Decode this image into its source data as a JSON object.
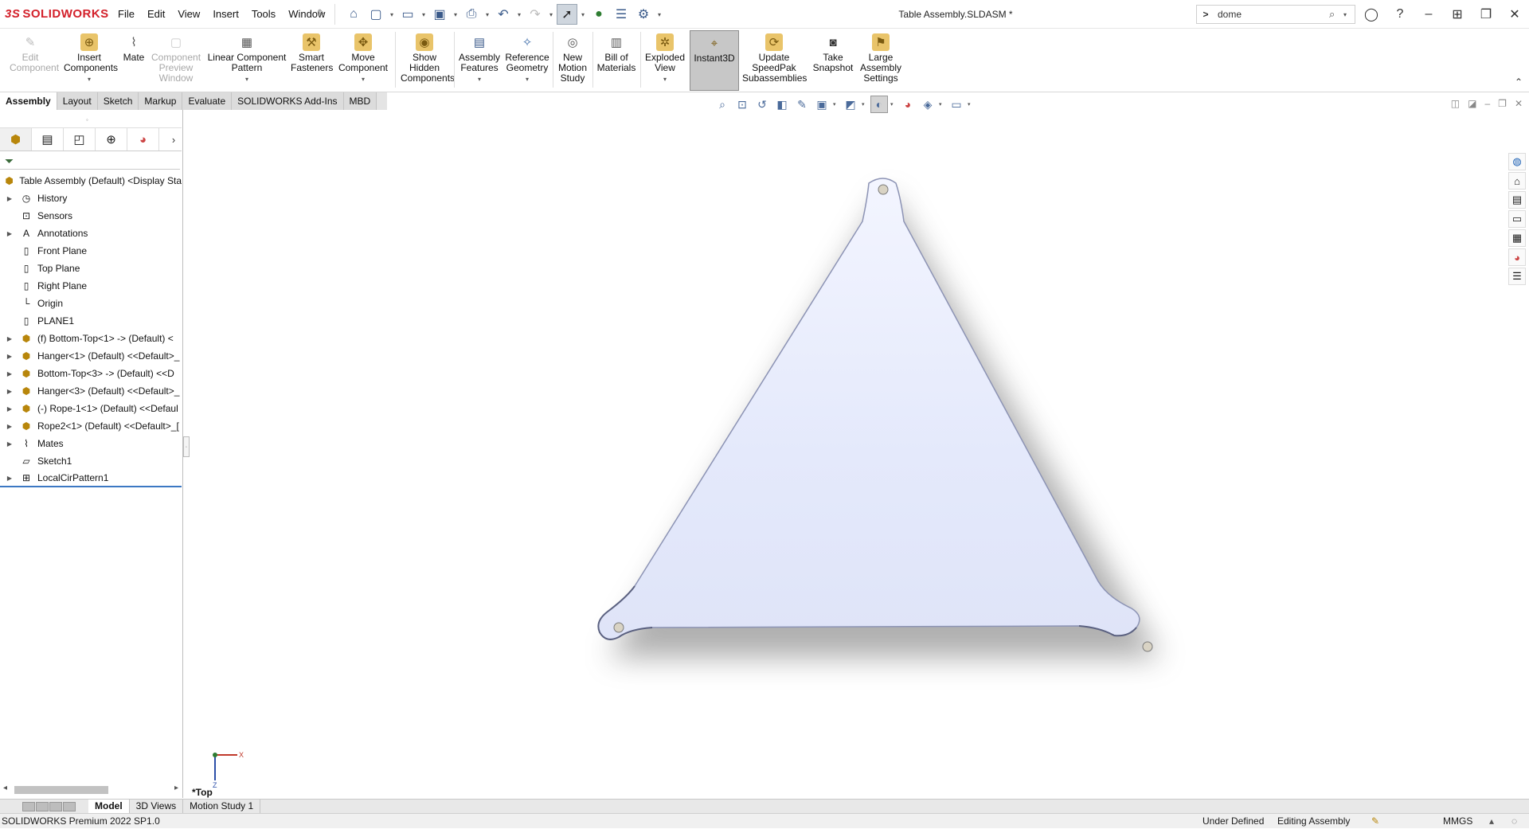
{
  "app": {
    "brand": "SOLIDWORKS",
    "brand_prefix": "3S"
  },
  "menu": [
    "File",
    "Edit",
    "View",
    "Insert",
    "Tools",
    "Window"
  ],
  "window_title": "Table Assembly.SLDASM *",
  "search": {
    "value": "dome"
  },
  "ribbon": {
    "edit_component": "Edit Component",
    "insert_components": "Insert Components",
    "mate": "Mate",
    "component_preview": "Component Preview Window",
    "linear_pattern": "Linear Component Pattern",
    "smart_fasteners": "Smart Fasteners",
    "move_component": "Move Component",
    "show_hidden": "Show Hidden Components",
    "assembly_features": "Assembly Features",
    "reference_geometry": "Reference Geometry",
    "new_motion_study": "New Motion Study",
    "bill_of_materials": "Bill of Materials",
    "exploded_view": "Exploded View",
    "instant3d": "Instant3D",
    "update_speedpak": "Update SpeedPak Subassemblies",
    "take_snapshot": "Take Snapshot",
    "large_assembly": "Large Assembly Settings"
  },
  "tabs": [
    "Assembly",
    "Layout",
    "Sketch",
    "Markup",
    "Evaluate",
    "SOLIDWORKS Add-Ins",
    "MBD"
  ],
  "tree": {
    "root": "Table Assembly (Default) <Display Sta",
    "items": [
      {
        "label": "History"
      },
      {
        "label": "Sensors"
      },
      {
        "label": "Annotations"
      },
      {
        "label": "Front Plane"
      },
      {
        "label": "Top Plane"
      },
      {
        "label": "Right Plane"
      },
      {
        "label": "Origin"
      },
      {
        "label": "PLANE1"
      },
      {
        "label": "(f) Bottom-Top<1> -> (Default) <"
      },
      {
        "label": "Hanger<1> (Default) <<Default>_"
      },
      {
        "label": "Bottom-Top<3> -> (Default) <<D"
      },
      {
        "label": "Hanger<3> (Default) <<Default>_"
      },
      {
        "label": "(-) Rope-1<1> (Default) <<Defaul"
      },
      {
        "label": "Rope2<1> (Default) <<Default>_[ "
      },
      {
        "label": "Mates"
      },
      {
        "label": "Sketch1"
      },
      {
        "label": "LocalCirPattern1"
      }
    ]
  },
  "viewport": {
    "view_name": "*Top",
    "triad_x": "X",
    "triad_z": "Z"
  },
  "bottom_tabs": [
    "Model",
    "3D Views",
    "Motion Study 1"
  ],
  "status": {
    "version": "SOLIDWORKS Premium 2022 SP1.0",
    "definition": "Under Defined",
    "mode": "Editing Assembly",
    "units": "MMGS"
  }
}
